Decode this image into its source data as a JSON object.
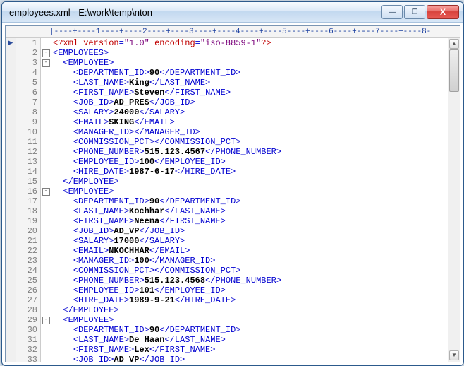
{
  "window": {
    "title": "employees.xml - E:\\work\\temp\\nton"
  },
  "ruler": "|----+----1----+----2----+----3----+----4----+----5----+----6----+----7----+----8-",
  "buttons": {
    "min": "—",
    "max": "❐",
    "close": "X"
  },
  "lines": [
    {
      "n": 1,
      "fold": "",
      "indent": 0,
      "kind": "decl"
    },
    {
      "n": 2,
      "fold": "-",
      "indent": 0,
      "kind": "open",
      "tag": "EMPLOYEES"
    },
    {
      "n": 3,
      "fold": "-",
      "indent": 1,
      "kind": "open",
      "tag": "EMPLOYEE"
    },
    {
      "n": 4,
      "fold": "",
      "indent": 2,
      "kind": "leaf",
      "tag": "DEPARTMENT_ID",
      "text": "90"
    },
    {
      "n": 5,
      "fold": "",
      "indent": 2,
      "kind": "leaf",
      "tag": "LAST_NAME",
      "text": "King"
    },
    {
      "n": 6,
      "fold": "",
      "indent": 2,
      "kind": "leaf",
      "tag": "FIRST_NAME",
      "text": "Steven"
    },
    {
      "n": 7,
      "fold": "",
      "indent": 2,
      "kind": "leaf",
      "tag": "JOB_ID",
      "text": "AD_PRES"
    },
    {
      "n": 8,
      "fold": "",
      "indent": 2,
      "kind": "leaf",
      "tag": "SALARY",
      "text": "24000"
    },
    {
      "n": 9,
      "fold": "",
      "indent": 2,
      "kind": "leaf",
      "tag": "EMAIL",
      "text": "SKING"
    },
    {
      "n": 10,
      "fold": "",
      "indent": 2,
      "kind": "empty",
      "tag": "MANAGER_ID"
    },
    {
      "n": 11,
      "fold": "",
      "indent": 2,
      "kind": "empty",
      "tag": "COMMISSION_PCT"
    },
    {
      "n": 12,
      "fold": "",
      "indent": 2,
      "kind": "leaf",
      "tag": "PHONE_NUMBER",
      "text": "515.123.4567"
    },
    {
      "n": 13,
      "fold": "",
      "indent": 2,
      "kind": "leaf",
      "tag": "EMPLOYEE_ID",
      "text": "100"
    },
    {
      "n": 14,
      "fold": "",
      "indent": 2,
      "kind": "leaf",
      "tag": "HIRE_DATE",
      "text": "1987-6-17"
    },
    {
      "n": 15,
      "fold": "",
      "indent": 1,
      "kind": "close",
      "tag": "EMPLOYEE"
    },
    {
      "n": 16,
      "fold": "-",
      "indent": 1,
      "kind": "open",
      "tag": "EMPLOYEE"
    },
    {
      "n": 17,
      "fold": "",
      "indent": 2,
      "kind": "leaf",
      "tag": "DEPARTMENT_ID",
      "text": "90"
    },
    {
      "n": 18,
      "fold": "",
      "indent": 2,
      "kind": "leaf",
      "tag": "LAST_NAME",
      "text": "Kochhar"
    },
    {
      "n": 19,
      "fold": "",
      "indent": 2,
      "kind": "leaf",
      "tag": "FIRST_NAME",
      "text": "Neena"
    },
    {
      "n": 20,
      "fold": "",
      "indent": 2,
      "kind": "leaf",
      "tag": "JOB_ID",
      "text": "AD_VP"
    },
    {
      "n": 21,
      "fold": "",
      "indent": 2,
      "kind": "leaf",
      "tag": "SALARY",
      "text": "17000"
    },
    {
      "n": 22,
      "fold": "",
      "indent": 2,
      "kind": "leaf",
      "tag": "EMAIL",
      "text": "NKOCHHAR"
    },
    {
      "n": 23,
      "fold": "",
      "indent": 2,
      "kind": "leaf",
      "tag": "MANAGER_ID",
      "text": "100"
    },
    {
      "n": 24,
      "fold": "",
      "indent": 2,
      "kind": "empty",
      "tag": "COMMISSION_PCT"
    },
    {
      "n": 25,
      "fold": "",
      "indent": 2,
      "kind": "leaf",
      "tag": "PHONE_NUMBER",
      "text": "515.123.4568"
    },
    {
      "n": 26,
      "fold": "",
      "indent": 2,
      "kind": "leaf",
      "tag": "EMPLOYEE_ID",
      "text": "101"
    },
    {
      "n": 27,
      "fold": "",
      "indent": 2,
      "kind": "leaf",
      "tag": "HIRE_DATE",
      "text": "1989-9-21"
    },
    {
      "n": 28,
      "fold": "",
      "indent": 1,
      "kind": "close",
      "tag": "EMPLOYEE"
    },
    {
      "n": 29,
      "fold": "-",
      "indent": 1,
      "kind": "open",
      "tag": "EMPLOYEE"
    },
    {
      "n": 30,
      "fold": "",
      "indent": 2,
      "kind": "leaf",
      "tag": "DEPARTMENT_ID",
      "text": "90"
    },
    {
      "n": 31,
      "fold": "",
      "indent": 2,
      "kind": "leaf",
      "tag": "LAST_NAME",
      "text": "De Haan"
    },
    {
      "n": 32,
      "fold": "",
      "indent": 2,
      "kind": "leaf",
      "tag": "FIRST_NAME",
      "text": "Lex"
    },
    {
      "n": 33,
      "fold": "",
      "indent": 2,
      "kind": "leaf",
      "tag": "JOB_ID",
      "text": "AD_VP"
    }
  ],
  "decl": {
    "version_attr": "version",
    "version_val": "\"1.0\"",
    "encoding_attr": "encoding",
    "encoding_val": "\"iso-8859-1\""
  }
}
